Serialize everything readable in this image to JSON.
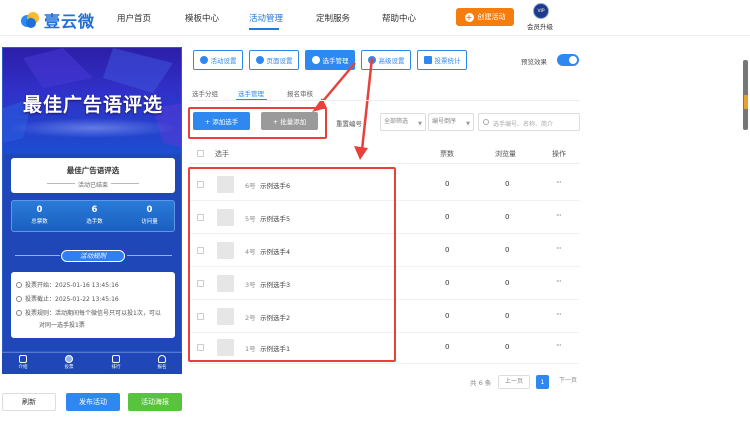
{
  "brand": {
    "name": "壹云微"
  },
  "nav": {
    "items": [
      "用户首页",
      "模板中心",
      "活动管理",
      "定制服务",
      "帮助中心"
    ],
    "active": "活动管理",
    "create_label": "创建活动",
    "vip_badge": "VIP",
    "vip_label": "会员升级"
  },
  "preview": {
    "banner_title": "最佳广告语评选",
    "card_title": "最佳广告语评选",
    "card_status": "活动已结束",
    "stats": [
      {
        "value": "0",
        "label": "总票数"
      },
      {
        "value": "6",
        "label": "选手数"
      },
      {
        "value": "0",
        "label": "访问量"
      }
    ],
    "rules_label": "活动规则",
    "info": {
      "start": "投票开始：2025-01-16 13:45:16",
      "end": "投票截止：2025-01-22 13:45:16",
      "rule_line1": "投票规则：活动期间每个微信号只可以投1次，可以",
      "rule_line2": "对同一选手投1票"
    },
    "tabs": [
      "介绍",
      "投票",
      "排行",
      "报名"
    ]
  },
  "bottom_buttons": {
    "refresh": "刷新",
    "publish": "发布活动",
    "poster": "活动海报"
  },
  "toolbar": {
    "buttons": [
      "活动设置",
      "页面设置",
      "选手管理",
      "高级设置",
      "投票统计"
    ],
    "active": "选手管理",
    "preview_label": "预览效果",
    "preview_on": true
  },
  "subtabs": {
    "items": [
      "选手分组",
      "选手管理",
      "报名审核"
    ],
    "active": "选手管理"
  },
  "actions": {
    "add": "+ 添加选手",
    "batch": "+ 批量添加",
    "reset": "重置编号",
    "filter": "全部筛选",
    "sort": "编号倒序",
    "search_placeholder": "选手编号、名称、简介"
  },
  "table": {
    "headers": {
      "name": "选手",
      "votes": "票数",
      "views": "浏览量",
      "ops": "操作"
    },
    "rows": [
      {
        "num": "6号",
        "name": "示例选手6",
        "votes": "0",
        "views": "0",
        "op": "···"
      },
      {
        "num": "5号",
        "name": "示例选手5",
        "votes": "0",
        "views": "0",
        "op": "···"
      },
      {
        "num": "4号",
        "name": "示例选手4",
        "votes": "0",
        "views": "0",
        "op": "···"
      },
      {
        "num": "3号",
        "name": "示例选手3",
        "votes": "0",
        "views": "0",
        "op": "···"
      },
      {
        "num": "2号",
        "name": "示例选手2",
        "votes": "0",
        "views": "0",
        "op": "···"
      },
      {
        "num": "1号",
        "name": "示例选手1",
        "votes": "0",
        "views": "0",
        "op": "···"
      }
    ]
  },
  "pagination": {
    "total": "共 6 条",
    "prev": "上一页",
    "current": "1",
    "next": "下一页"
  },
  "colors": {
    "primary": "#2f88f0",
    "orange": "#f57d0e",
    "green": "#58c33d",
    "annotation_red": "#e8413c"
  }
}
